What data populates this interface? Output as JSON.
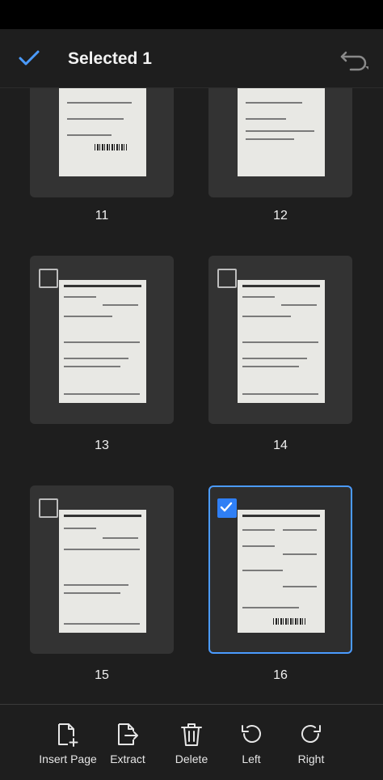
{
  "header": {
    "title": "Selected 1"
  },
  "pages": [
    {
      "number": "11",
      "selected": false
    },
    {
      "number": "12",
      "selected": false
    },
    {
      "number": "13",
      "selected": false
    },
    {
      "number": "14",
      "selected": false
    },
    {
      "number": "15",
      "selected": false
    },
    {
      "number": "16",
      "selected": true
    }
  ],
  "toolbar": {
    "insert_page": "Insert Page",
    "extract": "Extract",
    "delete": "Delete",
    "left": "Left",
    "right": "Right"
  },
  "colors": {
    "accent": "#2f7ff5",
    "selected_border": "#4b9bff",
    "background": "#1e1e1e",
    "tile": "#333333"
  }
}
